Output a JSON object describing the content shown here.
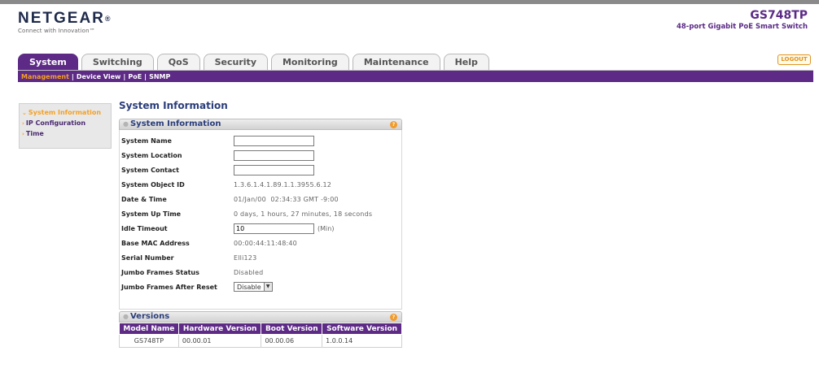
{
  "header": {
    "brand": "NETGEAR",
    "registered": "®",
    "tagline": "Connect with Innovation",
    "tagline_tm": "™",
    "model": "GS748TP",
    "model_desc": "48-port Gigabit PoE Smart Switch"
  },
  "tabs": [
    {
      "label": "System",
      "active": true
    },
    {
      "label": "Switching",
      "active": false
    },
    {
      "label": "QoS",
      "active": false
    },
    {
      "label": "Security",
      "active": false
    },
    {
      "label": "Monitoring",
      "active": false
    },
    {
      "label": "Maintenance",
      "active": false
    },
    {
      "label": "Help",
      "active": false
    }
  ],
  "logout_label": "LOGOUT",
  "subnav": [
    {
      "label": "Management",
      "active": true
    },
    {
      "label": "Device View",
      "active": false
    },
    {
      "label": "PoE",
      "active": false
    },
    {
      "label": "SNMP",
      "active": false
    }
  ],
  "subnav_separator": "|",
  "leftnav": [
    {
      "label": "System Information",
      "marker": "⌄",
      "active": true
    },
    {
      "label": "IP Configuration",
      "marker": "›",
      "active": false
    },
    {
      "label": "Time",
      "marker": "›",
      "active": false
    }
  ],
  "page_title": "System Information",
  "info_panel": {
    "title": "System Information",
    "help_glyph": "?",
    "fields": {
      "system_name": {
        "label": "System Name",
        "value": ""
      },
      "system_location": {
        "label": "System Location",
        "value": ""
      },
      "system_contact": {
        "label": "System Contact",
        "value": ""
      },
      "object_id": {
        "label": "System Object ID",
        "value": "1.3.6.1.4.1.89.1.1.3955.6.12"
      },
      "date_time": {
        "label": "Date & Time",
        "value": "01/Jan/00  02:34:33 GMT -9:00"
      },
      "up_time": {
        "label": "System Up Time",
        "value": "0 days, 1 hours, 27 minutes, 18 seconds"
      },
      "idle_timeout": {
        "label": "Idle Timeout",
        "value": "10",
        "unit": "(Min)"
      },
      "mac": {
        "label": "Base MAC Address",
        "value": "00:00:44:11:48:40"
      },
      "serial": {
        "label": "Serial Number",
        "value": "Elli123"
      },
      "jumbo_status": {
        "label": "Jumbo Frames Status",
        "value": "Disabled"
      },
      "jumbo_reset": {
        "label": "Jumbo Frames After Reset",
        "value": "Disable"
      }
    }
  },
  "versions_panel": {
    "title": "Versions",
    "help_glyph": "?",
    "columns": [
      "Model Name",
      "Hardware Version",
      "Boot Version",
      "Software Version"
    ],
    "row": [
      "GS748TP",
      "00.00.01",
      "00.00.06",
      "1.0.0.14"
    ]
  },
  "colors": {
    "accent_purple": "#5d2a86",
    "accent_orange": "#f3a024",
    "title_blue": "#2a3d7a"
  },
  "icons": {
    "help": "help-icon",
    "select_arrow": "chevron-down-icon"
  }
}
